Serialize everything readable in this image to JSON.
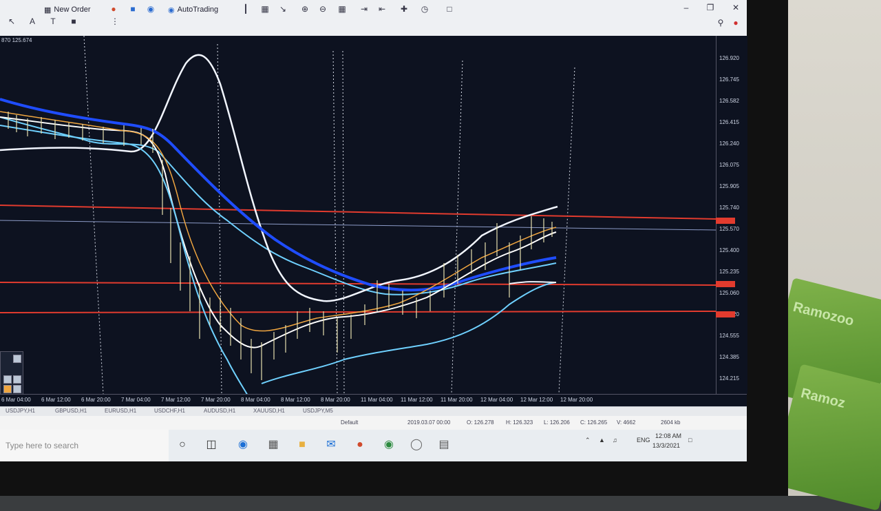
{
  "toolbar": {
    "new_order": "New Order",
    "auto_trading": "AutoTrading"
  },
  "chart_header": "870 125.674",
  "price_axis": [
    "126.920",
    "126.745",
    "126.582",
    "126.415",
    "126.240",
    "126.075",
    "125.905",
    "125.740",
    "125.570",
    "125.400",
    "125.235",
    "125.060",
    "124.720",
    "124.555",
    "124.385",
    "124.215"
  ],
  "time_axis": [
    "6 Mar 04:00",
    "6 Mar 12:00",
    "6 Mar 20:00",
    "7 Mar 04:00",
    "7 Mar 12:00",
    "7 Mar 20:00",
    "8 Mar 04:00",
    "8 Mar 12:00",
    "8 Mar 20:00",
    "11 Mar 04:00",
    "11 Mar 12:00",
    "11 Mar 20:00",
    "12 Mar 04:00",
    "12 Mar 12:00",
    "12 Mar 20:00"
  ],
  "tabs": [
    "USDJPY,H1",
    "GBPUSD,H1",
    "EURUSD,H1",
    "USDCHF,H1",
    "AUDUSD,H1",
    "XAUUSD,H1",
    "USDJPY,M5"
  ],
  "status": {
    "help": "Default",
    "datetime": "2019.03.07 00:00",
    "open": "O: 126.278",
    "high": "H: 126.323",
    "low": "L: 126.206",
    "close": "C: 126.265",
    "volume": "V: 4662",
    "traffic": "2604 kb"
  },
  "taskbar": {
    "search_placeholder": "Type here to search",
    "lang": "ENG",
    "time": "12:08 AM",
    "date": "13/3/2021"
  },
  "colors": {
    "chart_bg": "#0d1220",
    "blue_ma": "#1f4dff",
    "band": "#e8f2ff",
    "support": "#e23b2e"
  }
}
